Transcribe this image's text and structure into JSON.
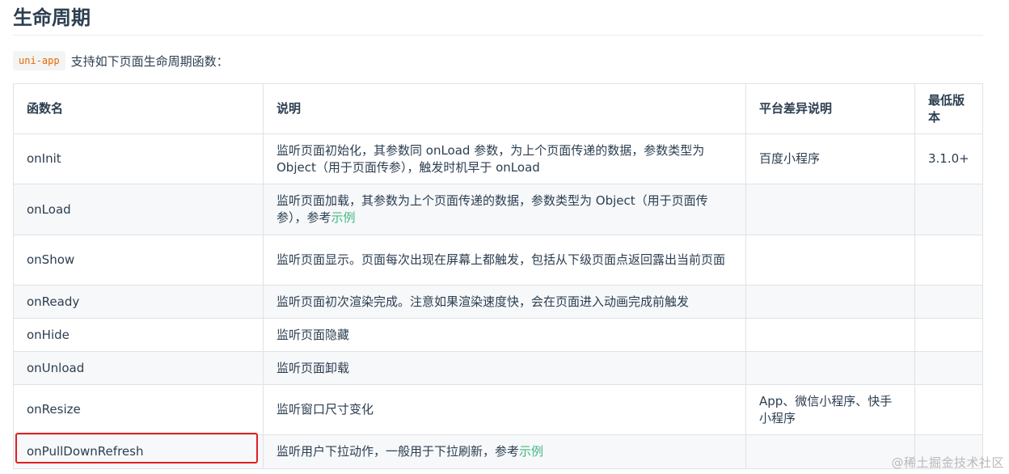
{
  "page": {
    "title": "生命周期",
    "intro_code": "uni-app",
    "intro_text": "支持如下页面生命周期函数："
  },
  "table": {
    "headers": [
      "函数名",
      "说明",
      "平台差异说明",
      "最低版本"
    ],
    "rows": [
      {
        "name": "onInit",
        "desc": "监听页面初始化，其参数同 onLoad 参数，为上个页面传递的数据，参数类型为 Object（用于页面传参），触发时机早于 onLoad",
        "desc_link": "",
        "platform": "百度小程序",
        "version": "3.1.0+"
      },
      {
        "name": "onLoad",
        "desc": "监听页面加载，其参数为上个页面传递的数据，参数类型为 Object（用于页面传参），参考",
        "desc_link": "示例",
        "platform": "",
        "version": ""
      },
      {
        "name": "onShow",
        "desc": "监听页面显示。页面每次出现在屏幕上都触发，包括从下级页面点返回露出当前页面",
        "desc_link": "",
        "platform": "",
        "version": ""
      },
      {
        "name": "onReady",
        "desc": "监听页面初次渲染完成。注意如果渲染速度快，会在页面进入动画完成前触发",
        "desc_link": "",
        "platform": "",
        "version": ""
      },
      {
        "name": "onHide",
        "desc": "监听页面隐藏",
        "desc_link": "",
        "platform": "",
        "version": ""
      },
      {
        "name": "onUnload",
        "desc": "监听页面卸载",
        "desc_link": "",
        "platform": "",
        "version": ""
      },
      {
        "name": "onResize",
        "desc": "监听窗口尺寸变化",
        "desc_link": "",
        "platform": "App、微信小程序、快手小程序",
        "version": ""
      },
      {
        "name": "onPullDownRefresh",
        "desc": "监听用户下拉动作，一般用于下拉刷新，参考",
        "desc_link": "示例",
        "platform": "",
        "version": ""
      }
    ]
  },
  "highlight": {
    "color": "#e02020",
    "target_row": "onPullDownRefresh"
  },
  "watermark": "@稀土掘金技术社区",
  "colors": {
    "text": "#2c3e50",
    "link": "#42b983",
    "code": "#e96900",
    "border": "#dfe2e5",
    "stripe": "#f6f8fa"
  }
}
